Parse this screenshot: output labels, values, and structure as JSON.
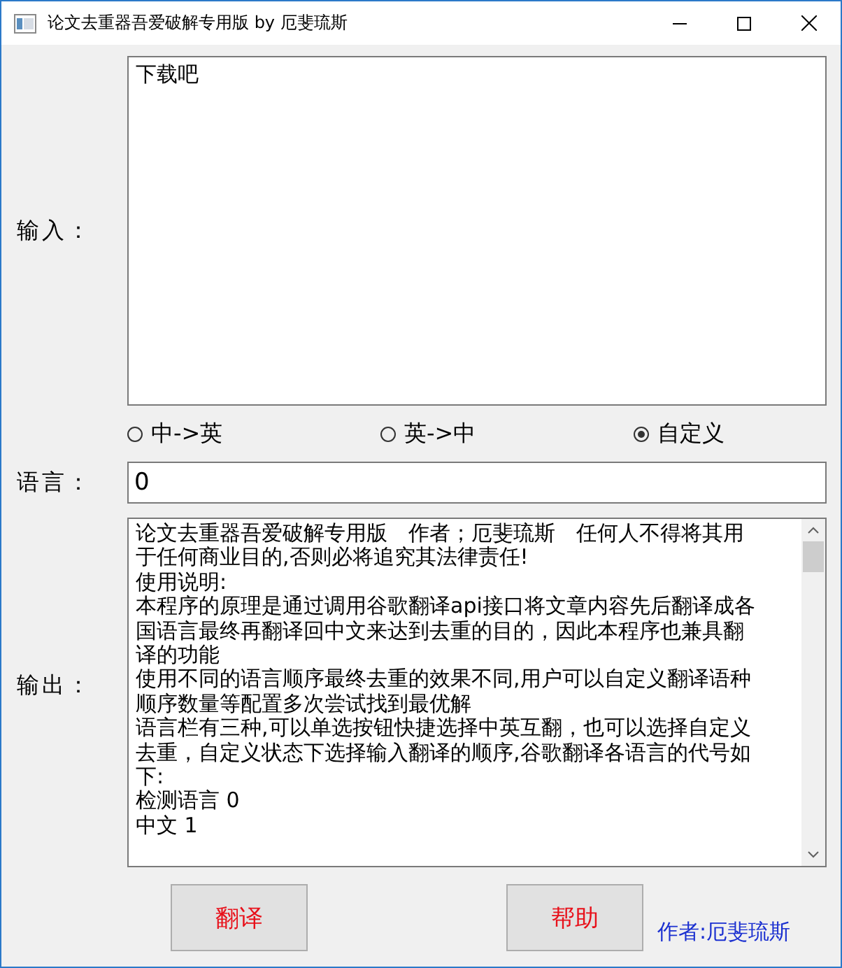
{
  "window": {
    "title": "论文去重器吾爱破解专用版 by 厄斐琉斯"
  },
  "input": {
    "label": "输入：",
    "value": "下载吧"
  },
  "direction_options": [
    {
      "label": "中->英",
      "selected": false
    },
    {
      "label": "英->中",
      "selected": false
    },
    {
      "label": "自定义",
      "selected": true
    }
  ],
  "language": {
    "label": "语言：",
    "value": "0"
  },
  "output": {
    "label": "输出：",
    "lines": [
      "论文去重器吾爱破解专用版　作者；厄斐琉斯　任何人不得将其用",
      "于任何商业目的,否则必将追究其法律责任!",
      "使用说明:",
      "本程序的原理是通过调用谷歌翻译api接口将文章内容先后翻译成各",
      "国语言最终再翻译回中文来达到去重的目的，因此本程序也兼具翻",
      "译的功能",
      "使用不同的语言顺序最终去重的效果不同,用户可以自定义翻译语种",
      "顺序数量等配置多次尝试找到最优解",
      "语言栏有三种,可以单选按钮快捷选择中英互翻，也可以选择自定义",
      "去重，自定义状态下选择输入翻译的顺序,谷歌翻译各语言的代号如",
      "下:",
      "检测语言 0",
      "中文 1"
    ]
  },
  "buttons": [
    "翻译",
    "帮助"
  ],
  "author": "作者:厄斐琉斯"
}
